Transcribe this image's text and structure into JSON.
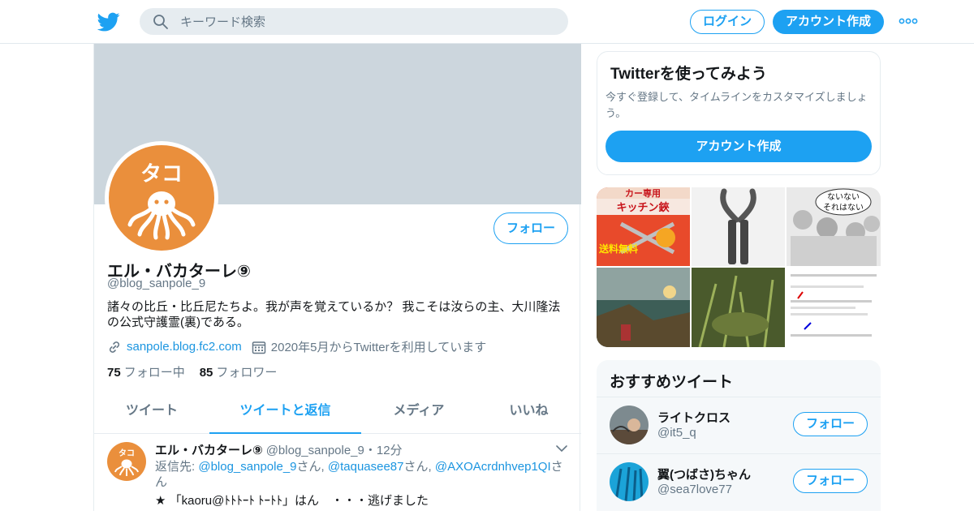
{
  "header": {
    "search_placeholder": "キーワード検索",
    "login_label": "ログイン",
    "signup_label": "アカウント作成"
  },
  "profile": {
    "follow_label": "フォロー",
    "name": "エル・バカターレ⑨",
    "handle": "@blog_sanpole_9",
    "bio": "諸々の比丘・比丘尼たちよ。我が声を覚えているか？ 我こそは汝らの主、大川隆法の公式守護霊(裏)である。",
    "link": "sanpole.blog.fc2.com",
    "joined": "2020年5月からTwitterを利用しています",
    "following_count": "75",
    "following_label": "フォロー中",
    "followers_count": "85",
    "followers_label": "フォロワー",
    "avatar_text": "タコ"
  },
  "tabs": [
    {
      "label": "ツイート"
    },
    {
      "label": "ツイートと返信"
    },
    {
      "label": "メディア"
    },
    {
      "label": "いいね"
    }
  ],
  "tweet": {
    "name": "エル・バカターレ⑨",
    "handle_time": "@blog_sanpole_9・12分",
    "reply_prefix": "返信先: ",
    "reply_user1": "@blog_sanpole_9",
    "san1": "さん, ",
    "reply_user2": "@taquasee87",
    "san2": "さん, ",
    "reply_user3": "@AXOAcrdnhvep1QI",
    "san3": "さん",
    "text": "★ 「kaoru@ﾄﾄﾄｰﾄ ﾄｰﾄﾄ」はん　・・・逃げました"
  },
  "signup_card": {
    "title": "Twitterを使ってみよう",
    "subtitle": "今すぐ登録して、タイムラインをカスタマイズしましょう。",
    "button_label": "アカウント作成"
  },
  "media_tiles": {
    "tile1_text1": "カー専用",
    "tile1_text2": "キッチン鋏",
    "tile1_text3": "送料無料",
    "tile3_text1": "ないない",
    "tile3_text2": "それはない"
  },
  "recommended": {
    "title": "おすすめツイート",
    "users": [
      {
        "name": "ライトクロス",
        "handle": "@it5_q",
        "follow_label": "フォロー"
      },
      {
        "name": "翼(つばさ)ちゃん",
        "handle": "@sea7love77",
        "follow_label": "フォロー"
      }
    ]
  },
  "colors": {
    "accent": "#1da1f2",
    "avatar_orange": "#ea8f3c",
    "banner": "#ccd6dd"
  },
  "icons": {
    "logo": "twitter-bird-icon",
    "search": "search-icon",
    "more": "more-dots-icon",
    "link": "link-icon",
    "calendar": "calendar-icon",
    "caret": "chevron-down-icon"
  }
}
